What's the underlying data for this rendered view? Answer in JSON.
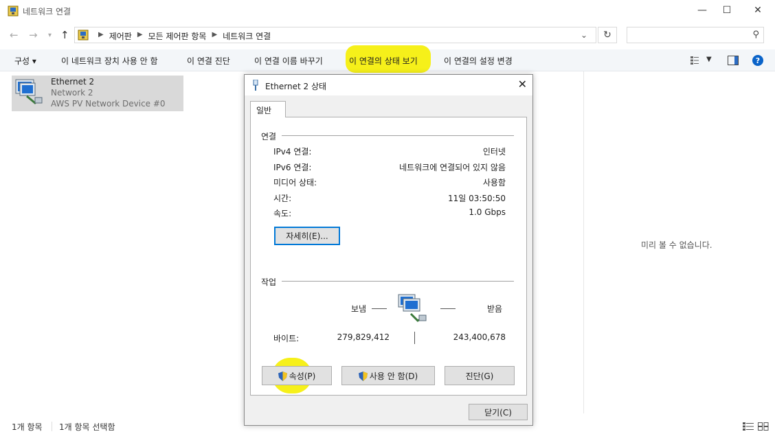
{
  "window": {
    "title": "네트워크 연결",
    "minimize": "—",
    "maximize": "☐",
    "close": "✕"
  },
  "address": {
    "crumbs": [
      "제어판",
      "모든 제어판 항목",
      "네트워크 연결"
    ],
    "search_placeholder": ""
  },
  "toolbar": {
    "organize": "구성 ▾",
    "disable": "이 네트워크 장치 사용 안 함",
    "diagnose": "이 연결 진단",
    "rename": "이 연결 이름 바꾸기",
    "view_status": "이 연결의 상태 보기",
    "change_settings": "이 연결의 설정 변경"
  },
  "connection_item": {
    "name": "Ethernet 2",
    "network": "Network 2",
    "device": "AWS PV Network Device #0"
  },
  "preview": {
    "empty_text": "미리 볼 수 없습니다."
  },
  "status_bar": {
    "count": "1개 항목",
    "selected": "1개 항목 선택함"
  },
  "dialog": {
    "title": "Ethernet 2 상태",
    "tab_general": "일반",
    "connection_group": "연결",
    "rows": [
      {
        "label": "IPv4 연결:",
        "value": "인터넷"
      },
      {
        "label": "IPv6 연결:",
        "value": "네트워크에 연결되어 있지 않음"
      },
      {
        "label": "미디어 상태:",
        "value": "사용함"
      },
      {
        "label": "시간:",
        "value": "11일 03:50:50"
      },
      {
        "label": "속도:",
        "value": "1.0 Gbps"
      }
    ],
    "details_button": "자세히(E)...",
    "activity_group": "작업",
    "sent_label": "보냄",
    "received_label": "받음",
    "bytes_label": "바이트:",
    "bytes_sent": "279,829,412",
    "bytes_received": "243,400,678",
    "properties_button": "속성(P)",
    "disable_button": "사용 안 함(D)",
    "diagnose_button": "진단(G)",
    "close_button": "닫기(C)"
  },
  "colors": {
    "highlight": "#f6f01a",
    "accent": "#0078d7",
    "selection": "#d9d9d9",
    "dialog_bg": "#f0f0f0"
  }
}
